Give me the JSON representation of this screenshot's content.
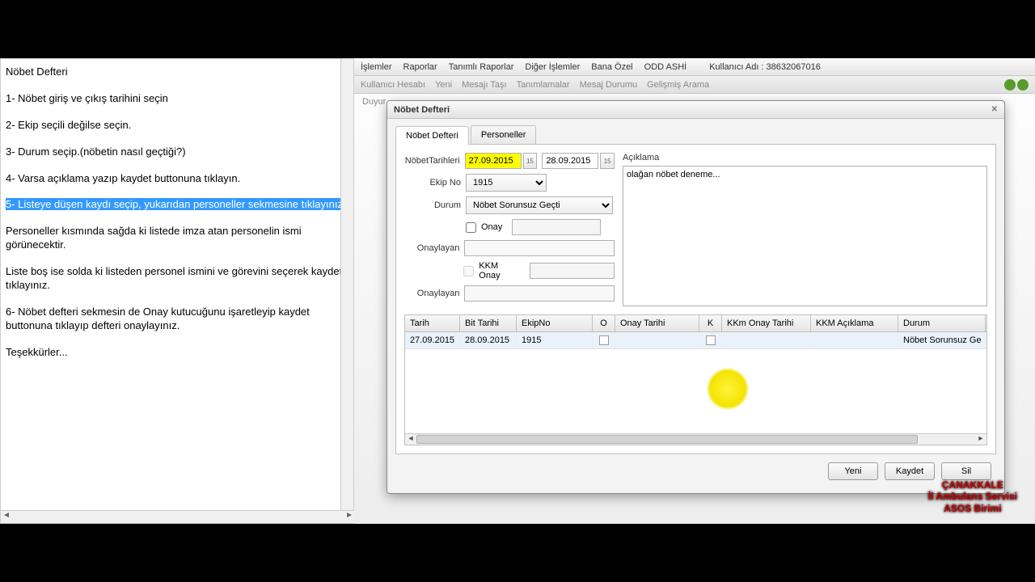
{
  "instructions": {
    "title": "Nöbet Defteri",
    "steps": [
      "1- Nöbet giriş ve çıkış tarihini seçin",
      "2- Ekip seçili değilse seçin.",
      "3- Durum seçip.(nöbetin nasıl geçtiği?)",
      "4- Varsa açıklama yazıp kaydet buttonuna tıklayın.",
      "5- Listeye düşen kaydı seçip, yukarıdan personeller sekmesine tıklayınız.",
      "Personeller kısmında sağda ki listede imza atan personelin ismi görünecektir.",
      "Liste boş ise solda ki listeden personel ismini ve görevini seçerek kaydet tıklayınız.",
      "6- Nöbet defteri sekmesin de Onay kutucuğunu işaretleyip kaydet buttonuna tıklayıp defteri onaylayınız.",
      "Teşekkürler..."
    ]
  },
  "menubar": {
    "items": [
      "İşlemler",
      "Raporlar",
      "Tanımlı Raporlar",
      "Diğer İşlemler",
      "Bana Özel",
      "ODD ASHİ"
    ],
    "user_label": "Kullanıcı Adı : 38632067016"
  },
  "toolbar": {
    "items": [
      "Kullanıcı Hesabı",
      "Yeni",
      "Mesajı Taşı",
      "Tanımlamalar",
      "Mesaj Durumu",
      "Gelişmiş Arama"
    ]
  },
  "breadcrumb": "Duyur",
  "dialog": {
    "title": "Nöbet Defteri",
    "tabs": {
      "t0": "Nöbet Defteri",
      "t1": "Personeller"
    },
    "form": {
      "nobet_tarih_label": "NöbetTarihleri",
      "date_start": "27.09.2015",
      "date_end": "28.09.2015",
      "ekip_label": "Ekip No",
      "ekip_val": "1915",
      "durum_label": "Durum",
      "durum_val": "Nöbet Sorunsuz Geçti",
      "onay_label": "Onay",
      "onaylayan_label": "Onaylayan",
      "kkm_label": "KKM Onay",
      "aciklama_label": "Açıklama",
      "aciklama_val": "olağan nöbet deneme..."
    },
    "grid": {
      "headers": {
        "tarih": "Tarih",
        "bit": "Bit Tarihi",
        "ek": "EkipNo",
        "o": "O",
        "ot": "Onay Tarihi",
        "k": "K",
        "kkm": "KKm Onay Tarihi",
        "kkma": "KKM Açıklama",
        "durum": "Durum"
      },
      "row0": {
        "tarih": "27.09.2015",
        "bit": "28.09.2015",
        "ek": "1915",
        "ot": "",
        "kkm": "",
        "kkma": "",
        "durum": "Nöbet Sorunsuz Ge"
      }
    },
    "buttons": {
      "new": "Yeni",
      "save": "Kaydet",
      "delete": "Sil"
    }
  },
  "watermark": {
    "l1": "ÇANAKKALE",
    "l2": "İl Ambulans Servisi",
    "l3": "ASOS Birimi"
  }
}
